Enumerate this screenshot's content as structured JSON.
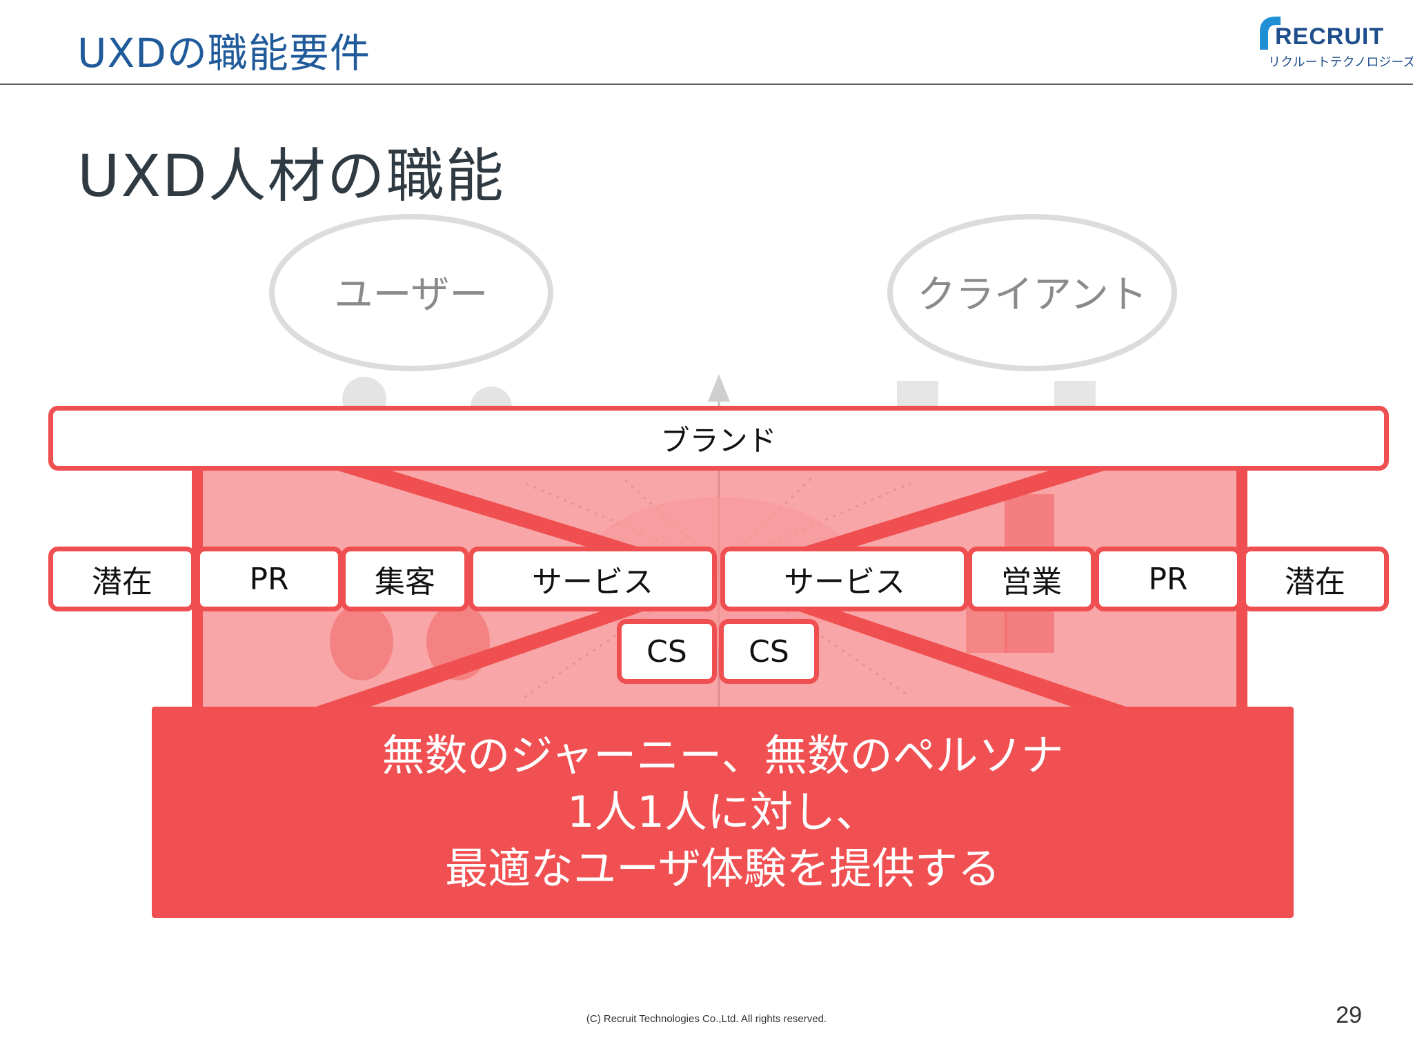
{
  "header": {
    "title": "UXDの職能要件"
  },
  "logo": {
    "word": "RECRUIT",
    "subtitle": "リクルートテクノロジーズ"
  },
  "slide": {
    "title": "UXD人材の職能"
  },
  "diagram": {
    "top_left_label": "ユーザー",
    "top_right_label": "クライアント",
    "brand": "ブランド",
    "row_left": [
      "潜在",
      "PR",
      "集客",
      "サービス"
    ],
    "row_right": [
      "サービス",
      "営業",
      "PR",
      "潜在"
    ],
    "cs": [
      "CS",
      "CS"
    ],
    "statement": [
      "無数のジャーニー、無数のペルソナ",
      "1人1人に対し、",
      "最適なユーザ体験を提供する"
    ]
  },
  "footer": {
    "copyright": "(C) Recruit Technologies Co.,Ltd. All rights reserved.",
    "page_number": "29"
  },
  "colors": {
    "accent": "#ef4f50",
    "header_text": "#1f5a9a",
    "brand_blue": "#1f4e8c"
  }
}
